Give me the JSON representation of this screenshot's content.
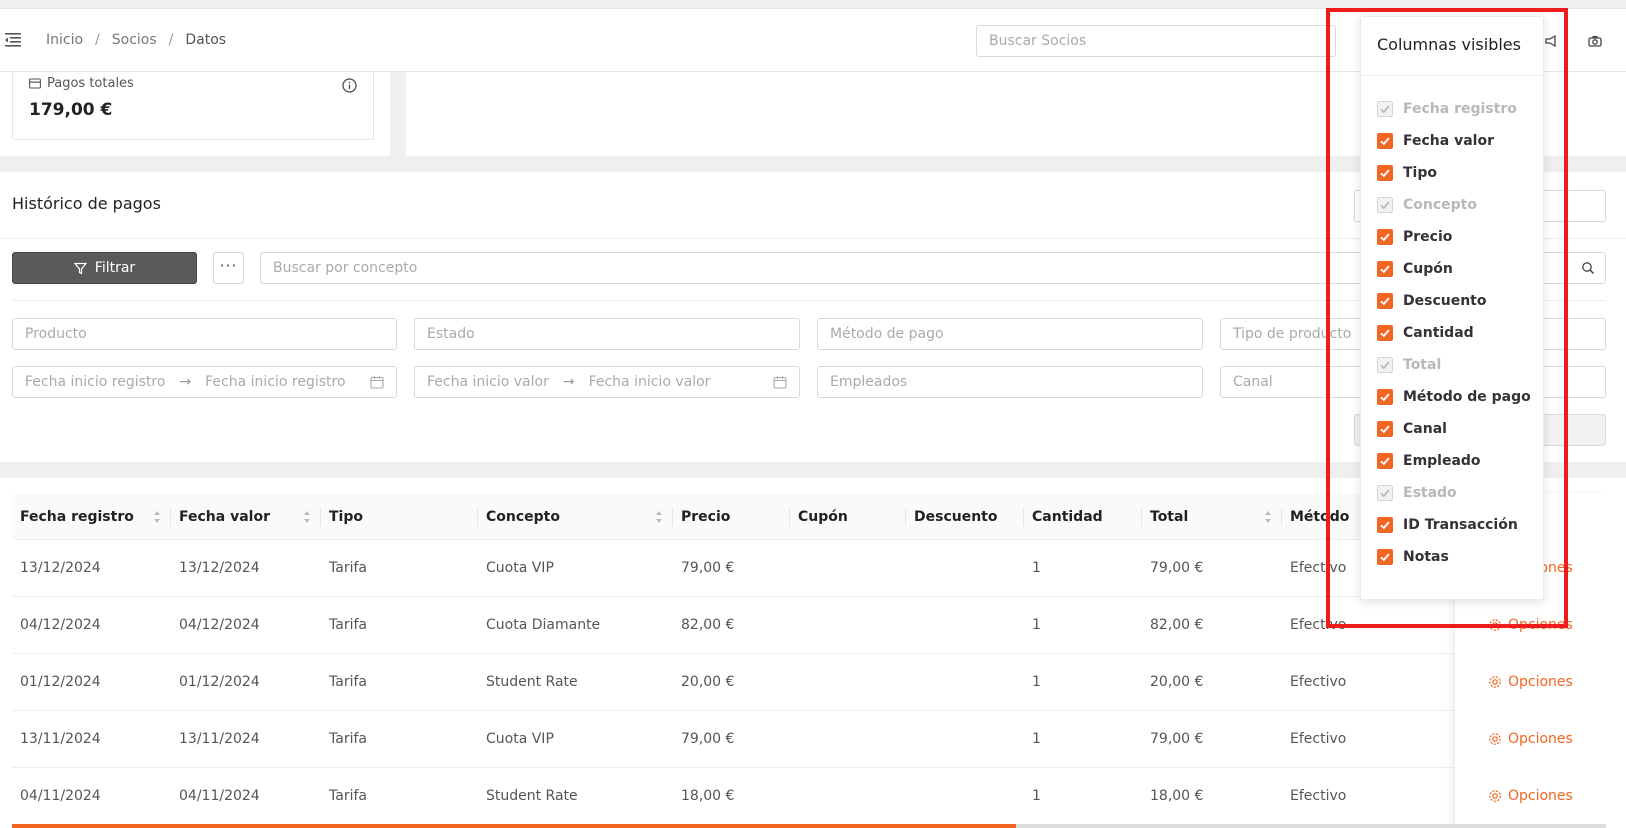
{
  "breadcrumb": {
    "home": "Inicio",
    "section": "Socios",
    "current": "Datos"
  },
  "top_search": {
    "placeholder": "Buscar Socios"
  },
  "payments_card": {
    "label": "Pagos totales",
    "value": "179,00 €"
  },
  "history": {
    "title": "Histórico de pagos",
    "filter_label": "Filtrar",
    "more_label": "···",
    "concept_placeholder": "Buscar por concepto",
    "fields": {
      "product": "Producto",
      "status": "Estado",
      "payment_method": "Método de pago",
      "product_type": "Tipo de producto",
      "reg_start": "Fecha inicio registro",
      "reg_end": "Fecha inicio registro",
      "val_start": "Fecha inicio valor",
      "val_end": "Fecha inicio valor",
      "employees": "Empleados",
      "channel": "Canal",
      "arrow": "→"
    }
  },
  "table": {
    "headers": [
      "Fecha registro",
      "Fecha valor",
      "Tipo",
      "Concepto",
      "Precio",
      "Cupón",
      "Descuento",
      "Cantidad",
      "Total",
      "Método"
    ],
    "rows": [
      [
        "13/12/2024",
        "13/12/2024",
        "Tarifa",
        "Cuota VIP",
        "79,00 €",
        "",
        "",
        "1",
        "79,00 €",
        "Efectivo"
      ],
      [
        "04/12/2024",
        "04/12/2024",
        "Tarifa",
        "Cuota Diamante",
        "82,00 €",
        "",
        "",
        "1",
        "82,00 €",
        "Efectivo"
      ],
      [
        "01/12/2024",
        "01/12/2024",
        "Tarifa",
        "Student Rate",
        "20,00 €",
        "",
        "",
        "1",
        "20,00 €",
        "Efectivo"
      ],
      [
        "13/11/2024",
        "13/11/2024",
        "Tarifa",
        "Cuota VIP",
        "79,00 €",
        "",
        "",
        "1",
        "79,00 €",
        "Efectivo"
      ],
      [
        "04/11/2024",
        "04/11/2024",
        "Tarifa",
        "Student Rate",
        "18,00 €",
        "",
        "",
        "1",
        "18,00 €",
        "Efectivo"
      ]
    ],
    "options_label": "Opciones",
    "horizontal_scroll_fraction": 0.63
  },
  "column_popup": {
    "title": "Columnas visibles",
    "items": [
      {
        "label": "Fecha registro",
        "checked": true,
        "disabled": true
      },
      {
        "label": "Fecha valor",
        "checked": true,
        "disabled": false
      },
      {
        "label": "Tipo",
        "checked": true,
        "disabled": false
      },
      {
        "label": "Concepto",
        "checked": true,
        "disabled": true
      },
      {
        "label": "Precio",
        "checked": true,
        "disabled": false
      },
      {
        "label": "Cupón",
        "checked": true,
        "disabled": false
      },
      {
        "label": "Descuento",
        "checked": true,
        "disabled": false
      },
      {
        "label": "Cantidad",
        "checked": true,
        "disabled": false
      },
      {
        "label": "Total",
        "checked": true,
        "disabled": true
      },
      {
        "label": "Método de pago",
        "checked": true,
        "disabled": false
      },
      {
        "label": "Canal",
        "checked": true,
        "disabled": false
      },
      {
        "label": "Empleado",
        "checked": true,
        "disabled": false
      },
      {
        "label": "Estado",
        "checked": true,
        "disabled": true
      },
      {
        "label": "ID Transacción",
        "checked": true,
        "disabled": false
      },
      {
        "label": "Notas",
        "checked": true,
        "disabled": false
      }
    ]
  },
  "colors": {
    "accent": "#f26522",
    "highlight": "#ee1c1c",
    "filter_button": "#5a5a5a"
  }
}
